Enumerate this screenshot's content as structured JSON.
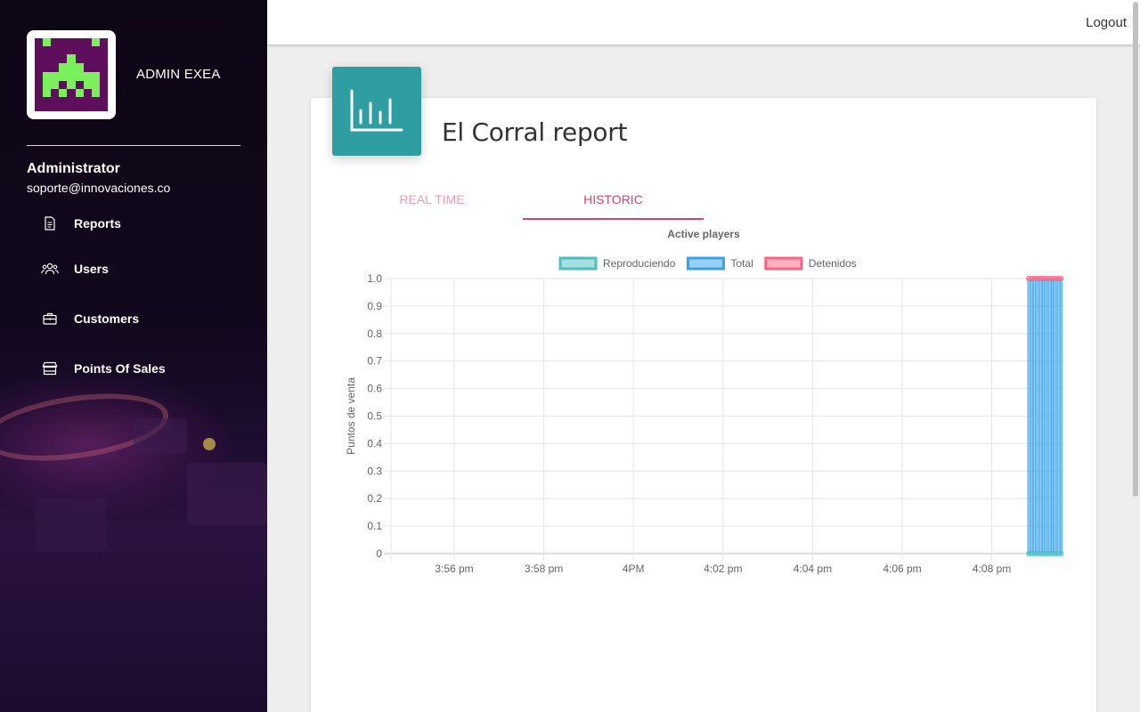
{
  "app": {
    "brand": "ADMIN EXEA"
  },
  "user": {
    "name": "Administrator",
    "email": "soporte@innovaciones.co"
  },
  "sidebar": {
    "items": [
      {
        "label": "Reports",
        "icon": "document-icon"
      },
      {
        "label": "Users",
        "icon": "users-icon"
      },
      {
        "label": "Customers",
        "icon": "briefcase-icon"
      },
      {
        "label": "Points Of Sales",
        "icon": "store-icon"
      }
    ]
  },
  "topbar": {
    "logout_label": "Logout"
  },
  "card": {
    "title": "El Corral report",
    "icon": "bar-chart-icon",
    "accent": "#2e9ea2"
  },
  "tabs": [
    {
      "label": "REAL TIME",
      "active": false
    },
    {
      "label": "HISTORIC",
      "active": true
    }
  ],
  "colors": {
    "tab_active": "#d04570",
    "tab_inactive": "#e4a0b7"
  },
  "chart_data": {
    "type": "bar",
    "title": "Active players",
    "ylabel": "Puntos de venta",
    "ylim": [
      0,
      1
    ],
    "yticks": [
      "0",
      "0.1",
      "0.2",
      "0.3",
      "0.4",
      "0.5",
      "0.6",
      "0.7",
      "0.8",
      "0.9",
      "1.0"
    ],
    "xticks": [
      "3:56 pm",
      "3:58 pm",
      "4PM",
      "4:02 pm",
      "4:04 pm",
      "4:06 pm",
      "4:08 pm"
    ],
    "grid": true,
    "legend_placement": "top",
    "series": [
      {
        "name": "Reproduciendo",
        "color": "#4bc0c0",
        "fill": "rgba(75,192,192,0.5)",
        "values": [
          0,
          0,
          0,
          0,
          0,
          0,
          0,
          0,
          0,
          0,
          0,
          0
        ]
      },
      {
        "name": "Total",
        "color": "#36a2eb",
        "fill": "rgba(54,162,235,0.5)",
        "values": [
          1,
          1,
          1,
          1,
          1,
          1,
          1,
          1,
          1,
          1,
          1,
          1
        ]
      },
      {
        "name": "Detenidos",
        "color": "#ff6384",
        "fill": "rgba(255,99,132,0.5)",
        "values": [
          1,
          1,
          1,
          1,
          1,
          1,
          1,
          1,
          1,
          1,
          1,
          1
        ]
      }
    ]
  }
}
